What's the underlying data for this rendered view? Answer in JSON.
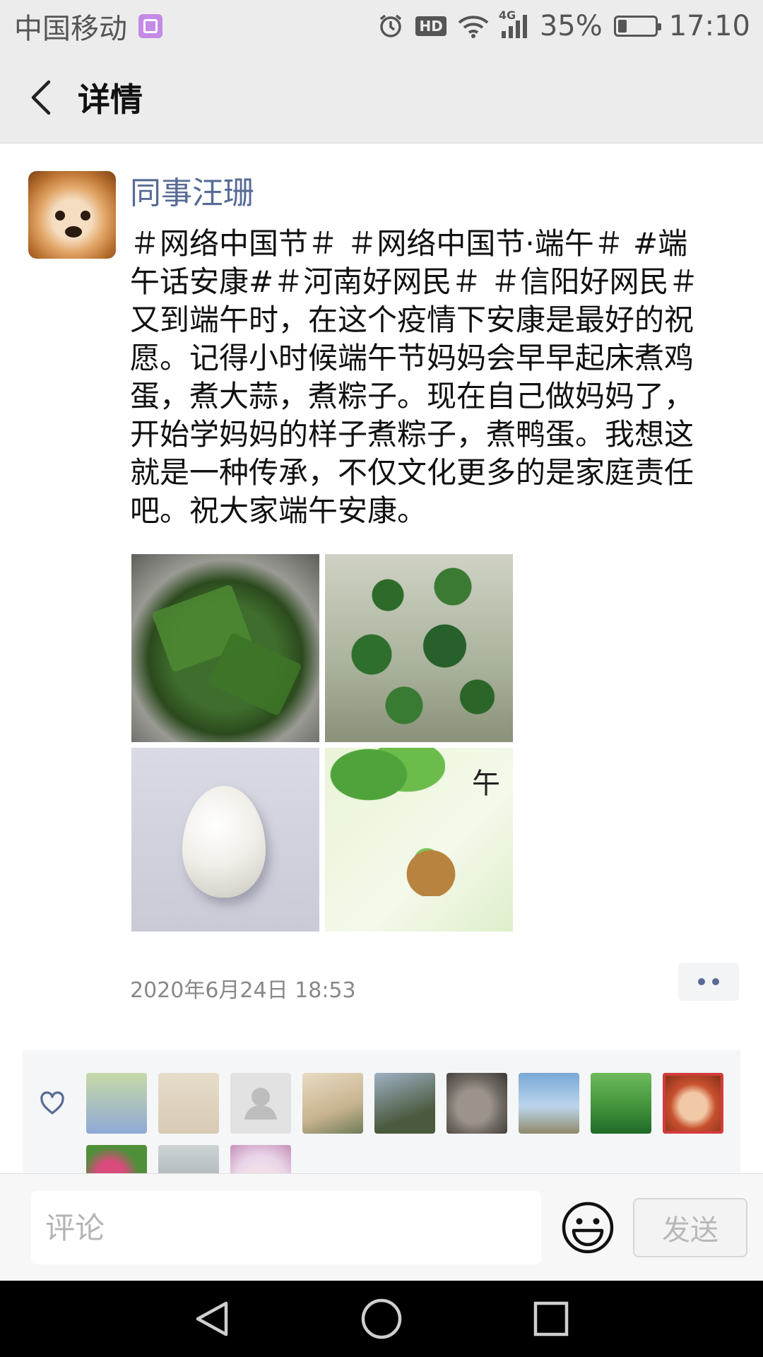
{
  "status_bar": {
    "carrier": "中国移动",
    "hd": "HD",
    "network": "4G",
    "battery": "35%",
    "time": "17:10"
  },
  "header": {
    "title": "详情"
  },
  "post": {
    "author": "同事汪珊",
    "text": "＃网络中国节＃ ＃网络中国节·端午＃ #端午话安康#＃河南好网民＃ ＃信阳好网民＃又到端午时，在这个疫情下安康是最好的祝愿。记得小时候端午节妈妈会早早起床煮鸡蛋，煮大蒜，煮粽子。现在自己做妈妈了，开始学妈妈的样子煮粽子，煮鸭蛋。我想这就是一种传承，不仅文化更多的是家庭责任吧。祝大家端午安康。",
    "photos": [
      "zongzi-pot",
      "mugwort-plants",
      "egg",
      "dragon-boat-festival-card"
    ],
    "card_character": "午",
    "timestamp": "2020年6月24日 18:53"
  },
  "likes": {
    "count_shown": 12,
    "avatar_colors": [
      "#8fa9d6",
      "#d8cbb4",
      "#e2e2e2",
      "#c9b38f",
      "#4a5a3e",
      "#6e6862",
      "#79a7d6",
      "#3f8f3a",
      "#c8502e",
      "#d84b7a",
      "#9aa4a6",
      "#e8d4e8"
    ]
  },
  "comment_bar": {
    "placeholder": "评论",
    "send_label": "发送"
  },
  "colors": {
    "link_blue": "#576b95",
    "header_bg": "#ececec"
  }
}
